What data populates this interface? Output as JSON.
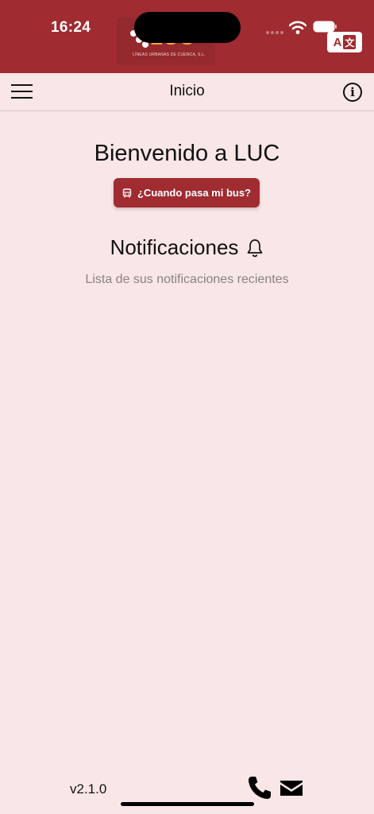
{
  "status_bar": {
    "time": "16:24",
    "background": "#a02b31",
    "icons": [
      "signal-icon",
      "wifi-icon",
      "battery-icon"
    ]
  },
  "logo": {
    "text": "LUC",
    "subtitle": "LÍNEAS URBANAS DE CUENCA, S.L."
  },
  "translate": {
    "left_glyph": "A",
    "right_glyph": "文"
  },
  "app_bar": {
    "title": "Inicio",
    "info_glyph": "i"
  },
  "main": {
    "welcome": "Bienvenido a LUC",
    "bus_button_label": "¿Cuando pasa mi bus?",
    "notifications_title": "Notificaciones",
    "notifications_subtitle": "Lista de sus notificaciones recientes"
  },
  "footer": {
    "version": "v2.1.0"
  },
  "colors": {
    "primary": "#a02b31",
    "background": "#f9e6e6",
    "accent": "#f4a340",
    "muted_text": "#8a8383"
  }
}
